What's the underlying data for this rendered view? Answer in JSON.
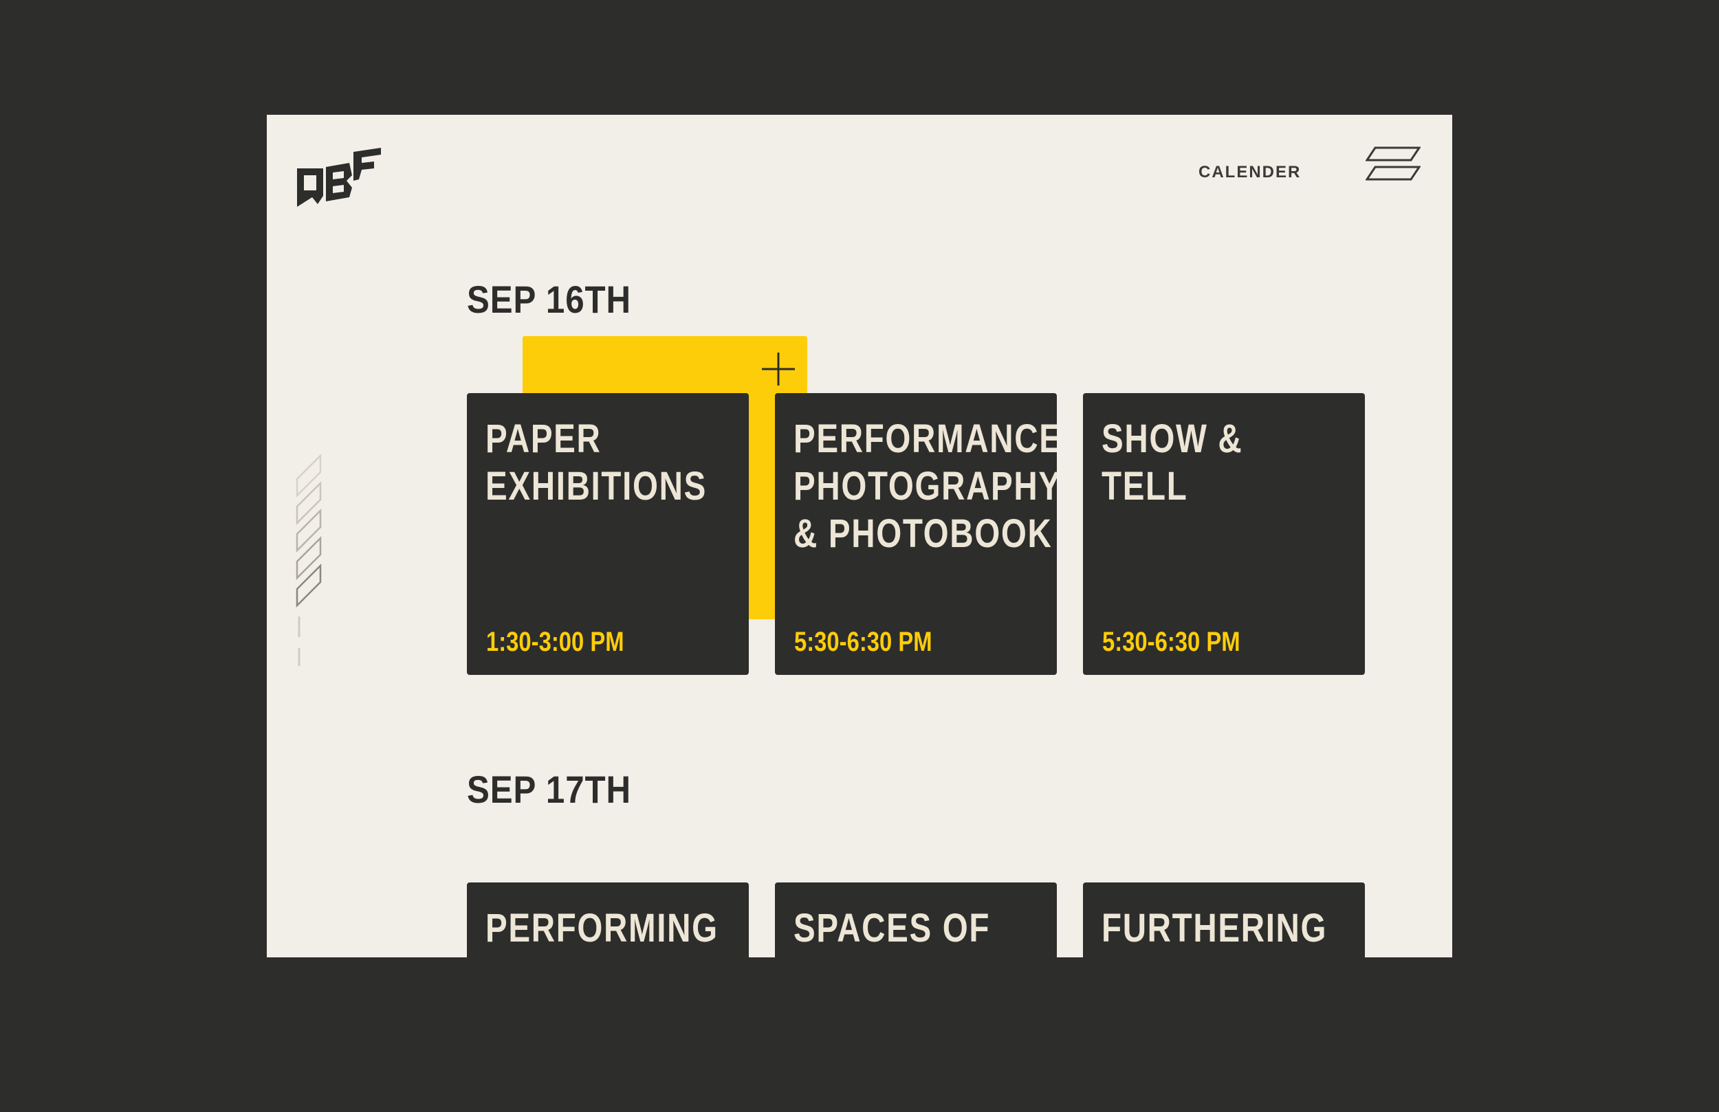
{
  "header": {
    "logo_text": "QBF",
    "nav_label": "CALENDER"
  },
  "colors": {
    "background": "#2d2d2c",
    "page": "#f2efe8",
    "card": "#2d2d2c",
    "accent": "#fdcd0a",
    "card_text": "#ede6d6"
  },
  "days": [
    {
      "date": "SEP 16TH",
      "events": [
        {
          "title": "PAPER\nEXHIBITIONS",
          "time": "1:30-3:00 PM"
        },
        {
          "title": "PERFORMANCE\nPHOTOGRAPHY\n& PHOTOBOOK",
          "time": "5:30-6:30 PM"
        },
        {
          "title": "SHOW &\nTELL",
          "time": "5:30-6:30 PM"
        }
      ]
    },
    {
      "date": "SEP 17TH",
      "events": [
        {
          "title": "PERFORMING"
        },
        {
          "title": "SPACES OF"
        },
        {
          "title": "FURTHERING"
        }
      ]
    }
  ]
}
